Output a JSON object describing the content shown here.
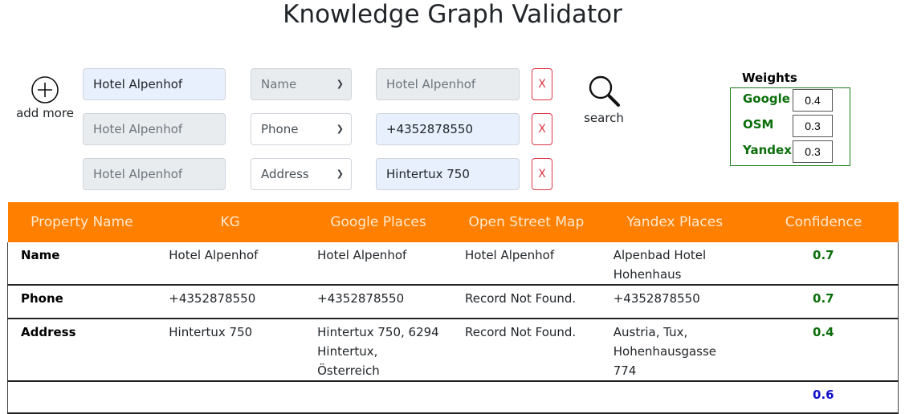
{
  "title": "Knowledge Graph Validator",
  "controls": {
    "add_more_label": "add more",
    "search_label": "search",
    "rows": [
      {
        "entity": "Hotel Alpenhof",
        "property": "Name",
        "value": "Hotel Alpenhof",
        "remove_label": "X"
      },
      {
        "entity": "Hotel Alpenhof",
        "property": "Phone",
        "value": "+4352878550",
        "remove_label": "X"
      },
      {
        "entity": "Hotel Alpenhof",
        "property": "Address",
        "value": "Hintertux 750",
        "remove_label": "X"
      }
    ]
  },
  "weights": {
    "title": "Weights",
    "items": [
      {
        "label": "Google",
        "value": "0.4"
      },
      {
        "label": "OSM",
        "value": "0.3"
      },
      {
        "label": "Yandex",
        "value": "0.3"
      }
    ]
  },
  "table": {
    "headers": [
      "Property Name",
      "KG",
      "Google Places",
      "Open Street Map",
      "Yandex Places",
      "Confidence"
    ],
    "rows": [
      {
        "property": "Name",
        "kg": "Hotel Alpenhof",
        "google": "Hotel Alpenhof",
        "osm": "Hotel Alpenhof",
        "yandex": "Alpenbad Hotel Hohenhaus",
        "confidence": "0.7"
      },
      {
        "property": "Phone",
        "kg": "+4352878550",
        "google": "+4352878550",
        "osm": "Record Not Found.",
        "yandex": "+4352878550",
        "confidence": "0.7"
      },
      {
        "property": "Address",
        "kg": "Hintertux 750",
        "google": "Hintertux 750, 6294 Hintertux, Österreich",
        "osm": "Record Not Found.",
        "yandex": "Austria, Tux, Hohenhausgasse 774",
        "confidence": "0.4"
      }
    ],
    "total_confidence": "0.6"
  },
  "colors": {
    "header_bg": "#ff8000",
    "confidence": "#0b6e0b",
    "total_confidence": "#1010c8",
    "remove_button": "#dc3545"
  }
}
